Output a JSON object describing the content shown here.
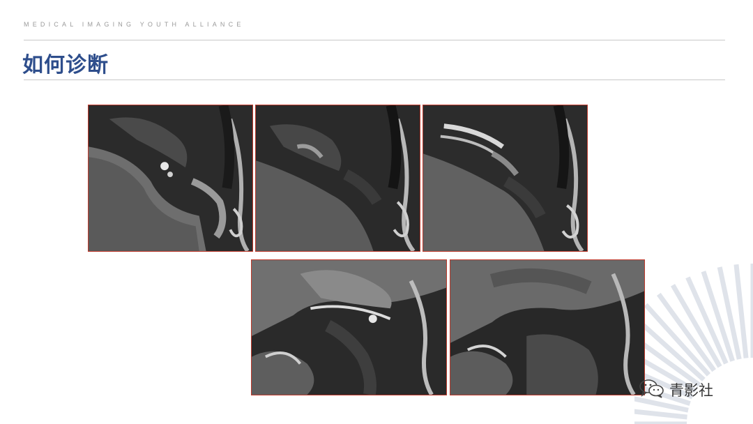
{
  "header": {
    "org_name": "MEDICAL IMAGING YOUTH ALLIANCE"
  },
  "slide": {
    "title": "如何诊断"
  },
  "images": [
    {
      "name": "mri-sagittal-1",
      "description_icon": "mri-scan"
    },
    {
      "name": "mri-sagittal-2",
      "description_icon": "mri-scan"
    },
    {
      "name": "mri-sagittal-3",
      "description_icon": "mri-scan"
    },
    {
      "name": "mri-coronal-1",
      "description_icon": "mri-scan"
    },
    {
      "name": "mri-coronal-2",
      "description_icon": "mri-scan"
    }
  ],
  "watermark": {
    "text": "青影社",
    "icon": "wechat-icon"
  },
  "colors": {
    "accent": "#2e4e8c",
    "image_border": "#c0392b",
    "rule": "#c8c8c8"
  }
}
